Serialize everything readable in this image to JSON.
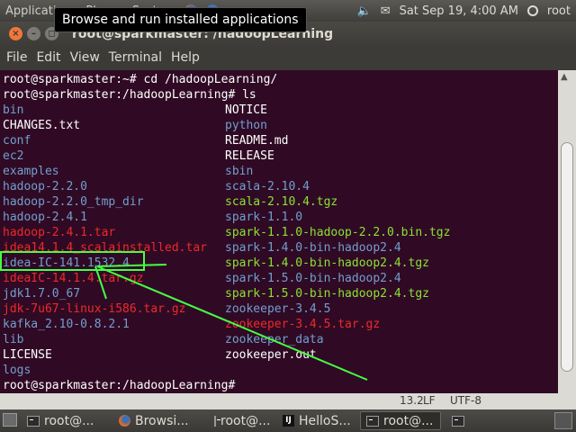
{
  "top_panel": {
    "menus": [
      "Applications",
      "Places",
      "System"
    ],
    "clock": "Sat Sep 19,  4:00 AM",
    "user": "root",
    "icons": [
      "firefox-icon",
      "help-icon",
      "volume-icon",
      "mail-icon",
      "power-icon"
    ]
  },
  "tooltip": "Browse and run installed applications",
  "window": {
    "title": "root@sparkmaster: /hadoopLearning",
    "buttons": [
      "×",
      "–",
      "◻"
    ],
    "menus": [
      "File",
      "Edit",
      "View",
      "Terminal",
      "Help"
    ]
  },
  "terminal": {
    "lines": [
      "root@sparkmaster:~# cd /hadoopLearning/",
      "root@sparkmaster:/hadoopLearning# ls"
    ],
    "listing_left": [
      {
        "text": "bin",
        "type": "dir"
      },
      {
        "text": "CHANGES.txt",
        "type": "plain"
      },
      {
        "text": "conf",
        "type": "dir"
      },
      {
        "text": "ec2",
        "type": "dir"
      },
      {
        "text": "examples",
        "type": "dir"
      },
      {
        "text": "hadoop-2.2.0",
        "type": "dir"
      },
      {
        "text": "hadoop-2.2.0_tmp_dir",
        "type": "dir"
      },
      {
        "text": "hadoop-2.4.1",
        "type": "dir"
      },
      {
        "text": "hadoop-2.4.1.tar",
        "type": "arc"
      },
      {
        "text": "idea14.1.4_scalainstalled.tar",
        "type": "arc"
      },
      {
        "text": "idea-IC-141.1532.4",
        "type": "dir"
      },
      {
        "text": "ideaIC-14.1.4.tar.gz",
        "type": "arc"
      },
      {
        "text": "jdk1.7.0_67",
        "type": "dir"
      },
      {
        "text": "jdk-7u67-linux-i586.tar.gz",
        "type": "arc"
      },
      {
        "text": "kafka_2.10-0.8.2.1",
        "type": "dir"
      },
      {
        "text": "lib",
        "type": "dir"
      },
      {
        "text": "LICENSE",
        "type": "plain"
      },
      {
        "text": "logs",
        "type": "dir"
      }
    ],
    "listing_right": [
      {
        "text": "NOTICE",
        "type": "plain"
      },
      {
        "text": "python",
        "type": "dir"
      },
      {
        "text": "README.md",
        "type": "plain"
      },
      {
        "text": "RELEASE",
        "type": "plain"
      },
      {
        "text": "sbin",
        "type": "dir"
      },
      {
        "text": "scala-2.10.4",
        "type": "dir"
      },
      {
        "text": "scala-2.10.4.tgz",
        "type": "exe"
      },
      {
        "text": "spark-1.1.0",
        "type": "dir"
      },
      {
        "text": "spark-1.1.0-hadoop-2.2.0.bin.tgz",
        "type": "exe"
      },
      {
        "text": "spark-1.4.0-bin-hadoop2.4",
        "type": "dir"
      },
      {
        "text": "spark-1.4.0-bin-hadoop2.4.tgz",
        "type": "exe"
      },
      {
        "text": "spark-1.5.0-bin-hadoop2.4",
        "type": "dir"
      },
      {
        "text": "spark-1.5.0-bin-hadoop2.4.tgz",
        "type": "exe"
      },
      {
        "text": "zookeeper-3.4.5",
        "type": "dir"
      },
      {
        "text": "zookeeper-3.4.5.tar.gz",
        "type": "arc"
      },
      {
        "text": "zookeeper_data",
        "type": "dir"
      },
      {
        "text": "zookeeper.out",
        "type": "plain"
      }
    ],
    "prompt": "root@sparkmaster:/hadoopLearning#"
  },
  "status_strip": {
    "pos": "13.2",
    "eol": "LF",
    "enc": "UTF-8"
  },
  "taskbar": {
    "tasks": [
      {
        "label": "root@...",
        "icon": "terminal-icon"
      },
      {
        "label": "Browsi...",
        "icon": "firefox-icon"
      },
      {
        "label": "root@...",
        "icon": "terminal-icon"
      },
      {
        "label": "HelloS...",
        "icon": "intellij-icon"
      },
      {
        "label": "root@...",
        "icon": "terminal-icon",
        "active": true
      }
    ]
  },
  "colors": {
    "terminal_bg": "#300a24",
    "dir": "#729fcf",
    "exe": "#8ae234",
    "archive": "#ef2929",
    "annotation": "#44ff44"
  }
}
